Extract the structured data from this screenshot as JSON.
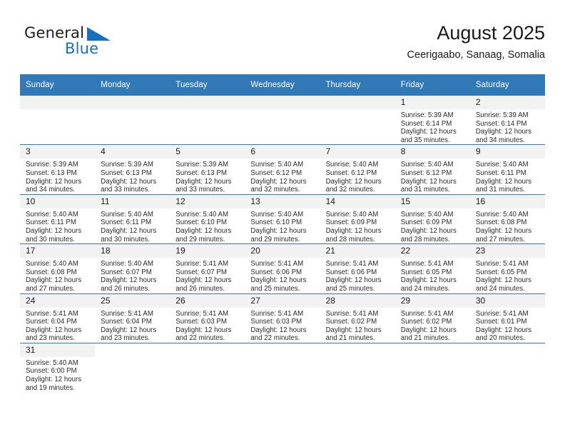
{
  "brand": {
    "word1": "General",
    "word2": "Blue",
    "flag_color": "#1670bf",
    "text_color": "#1c1c1c"
  },
  "header": {
    "title": "August 2025",
    "subtitle": "Ceerigaabo, Sanaag, Somalia"
  },
  "theme": {
    "header_blue": "#3279b7",
    "daynum_band": "#f2f2f2",
    "text": "#1a1a1a"
  },
  "calendar": {
    "weekday_headers": [
      "Sunday",
      "Monday",
      "Tuesday",
      "Wednesday",
      "Thursday",
      "Friday",
      "Saturday"
    ],
    "weeks": [
      [
        {
          "day": "",
          "empty": true
        },
        {
          "day": "",
          "empty": true
        },
        {
          "day": "",
          "empty": true
        },
        {
          "day": "",
          "empty": true
        },
        {
          "day": "",
          "empty": true
        },
        {
          "day": "1",
          "sunrise": "Sunrise: 5:39 AM",
          "sunset": "Sunset: 6:14 PM",
          "daylight1": "Daylight: 12 hours",
          "daylight2": "and 35 minutes."
        },
        {
          "day": "2",
          "sunrise": "Sunrise: 5:39 AM",
          "sunset": "Sunset: 6:14 PM",
          "daylight1": "Daylight: 12 hours",
          "daylight2": "and 34 minutes."
        }
      ],
      [
        {
          "day": "3",
          "sunrise": "Sunrise: 5:39 AM",
          "sunset": "Sunset: 6:13 PM",
          "daylight1": "Daylight: 12 hours",
          "daylight2": "and 34 minutes."
        },
        {
          "day": "4",
          "sunrise": "Sunrise: 5:39 AM",
          "sunset": "Sunset: 6:13 PM",
          "daylight1": "Daylight: 12 hours",
          "daylight2": "and 33 minutes."
        },
        {
          "day": "5",
          "sunrise": "Sunrise: 5:39 AM",
          "sunset": "Sunset: 6:13 PM",
          "daylight1": "Daylight: 12 hours",
          "daylight2": "and 33 minutes."
        },
        {
          "day": "6",
          "sunrise": "Sunrise: 5:40 AM",
          "sunset": "Sunset: 6:12 PM",
          "daylight1": "Daylight: 12 hours",
          "daylight2": "and 32 minutes."
        },
        {
          "day": "7",
          "sunrise": "Sunrise: 5:40 AM",
          "sunset": "Sunset: 6:12 PM",
          "daylight1": "Daylight: 12 hours",
          "daylight2": "and 32 minutes."
        },
        {
          "day": "8",
          "sunrise": "Sunrise: 5:40 AM",
          "sunset": "Sunset: 6:12 PM",
          "daylight1": "Daylight: 12 hours",
          "daylight2": "and 31 minutes."
        },
        {
          "day": "9",
          "sunrise": "Sunrise: 5:40 AM",
          "sunset": "Sunset: 6:11 PM",
          "daylight1": "Daylight: 12 hours",
          "daylight2": "and 31 minutes."
        }
      ],
      [
        {
          "day": "10",
          "sunrise": "Sunrise: 5:40 AM",
          "sunset": "Sunset: 6:11 PM",
          "daylight1": "Daylight: 12 hours",
          "daylight2": "and 30 minutes."
        },
        {
          "day": "11",
          "sunrise": "Sunrise: 5:40 AM",
          "sunset": "Sunset: 6:11 PM",
          "daylight1": "Daylight: 12 hours",
          "daylight2": "and 30 minutes."
        },
        {
          "day": "12",
          "sunrise": "Sunrise: 5:40 AM",
          "sunset": "Sunset: 6:10 PM",
          "daylight1": "Daylight: 12 hours",
          "daylight2": "and 29 minutes."
        },
        {
          "day": "13",
          "sunrise": "Sunrise: 5:40 AM",
          "sunset": "Sunset: 6:10 PM",
          "daylight1": "Daylight: 12 hours",
          "daylight2": "and 29 minutes."
        },
        {
          "day": "14",
          "sunrise": "Sunrise: 5:40 AM",
          "sunset": "Sunset: 6:09 PM",
          "daylight1": "Daylight: 12 hours",
          "daylight2": "and 28 minutes."
        },
        {
          "day": "15",
          "sunrise": "Sunrise: 5:40 AM",
          "sunset": "Sunset: 6:09 PM",
          "daylight1": "Daylight: 12 hours",
          "daylight2": "and 28 minutes."
        },
        {
          "day": "16",
          "sunrise": "Sunrise: 5:40 AM",
          "sunset": "Sunset: 6:08 PM",
          "daylight1": "Daylight: 12 hours",
          "daylight2": "and 27 minutes."
        }
      ],
      [
        {
          "day": "17",
          "sunrise": "Sunrise: 5:40 AM",
          "sunset": "Sunset: 6:08 PM",
          "daylight1": "Daylight: 12 hours",
          "daylight2": "and 27 minutes."
        },
        {
          "day": "18",
          "sunrise": "Sunrise: 5:40 AM",
          "sunset": "Sunset: 6:07 PM",
          "daylight1": "Daylight: 12 hours",
          "daylight2": "and 26 minutes."
        },
        {
          "day": "19",
          "sunrise": "Sunrise: 5:41 AM",
          "sunset": "Sunset: 6:07 PM",
          "daylight1": "Daylight: 12 hours",
          "daylight2": "and 26 minutes."
        },
        {
          "day": "20",
          "sunrise": "Sunrise: 5:41 AM",
          "sunset": "Sunset: 6:06 PM",
          "daylight1": "Daylight: 12 hours",
          "daylight2": "and 25 minutes."
        },
        {
          "day": "21",
          "sunrise": "Sunrise: 5:41 AM",
          "sunset": "Sunset: 6:06 PM",
          "daylight1": "Daylight: 12 hours",
          "daylight2": "and 25 minutes."
        },
        {
          "day": "22",
          "sunrise": "Sunrise: 5:41 AM",
          "sunset": "Sunset: 6:05 PM",
          "daylight1": "Daylight: 12 hours",
          "daylight2": "and 24 minutes."
        },
        {
          "day": "23",
          "sunrise": "Sunrise: 5:41 AM",
          "sunset": "Sunset: 6:05 PM",
          "daylight1": "Daylight: 12 hours",
          "daylight2": "and 24 minutes."
        }
      ],
      [
        {
          "day": "24",
          "sunrise": "Sunrise: 5:41 AM",
          "sunset": "Sunset: 6:04 PM",
          "daylight1": "Daylight: 12 hours",
          "daylight2": "and 23 minutes."
        },
        {
          "day": "25",
          "sunrise": "Sunrise: 5:41 AM",
          "sunset": "Sunset: 6:04 PM",
          "daylight1": "Daylight: 12 hours",
          "daylight2": "and 23 minutes."
        },
        {
          "day": "26",
          "sunrise": "Sunrise: 5:41 AM",
          "sunset": "Sunset: 6:03 PM",
          "daylight1": "Daylight: 12 hours",
          "daylight2": "and 22 minutes."
        },
        {
          "day": "27",
          "sunrise": "Sunrise: 5:41 AM",
          "sunset": "Sunset: 6:03 PM",
          "daylight1": "Daylight: 12 hours",
          "daylight2": "and 22 minutes."
        },
        {
          "day": "28",
          "sunrise": "Sunrise: 5:41 AM",
          "sunset": "Sunset: 6:02 PM",
          "daylight1": "Daylight: 12 hours",
          "daylight2": "and 21 minutes."
        },
        {
          "day": "29",
          "sunrise": "Sunrise: 5:41 AM",
          "sunset": "Sunset: 6:02 PM",
          "daylight1": "Daylight: 12 hours",
          "daylight2": "and 21 minutes."
        },
        {
          "day": "30",
          "sunrise": "Sunrise: 5:41 AM",
          "sunset": "Sunset: 6:01 PM",
          "daylight1": "Daylight: 12 hours",
          "daylight2": "and 20 minutes."
        }
      ],
      [
        {
          "day": "31",
          "sunrise": "Sunrise: 5:40 AM",
          "sunset": "Sunset: 6:00 PM",
          "daylight1": "Daylight: 12 hours",
          "daylight2": "and 19 minutes."
        },
        {
          "day": "",
          "blank": true
        },
        {
          "day": "",
          "blank": true
        },
        {
          "day": "",
          "blank": true
        },
        {
          "day": "",
          "blank": true
        },
        {
          "day": "",
          "blank": true
        },
        {
          "day": "",
          "blank": true
        }
      ]
    ]
  }
}
